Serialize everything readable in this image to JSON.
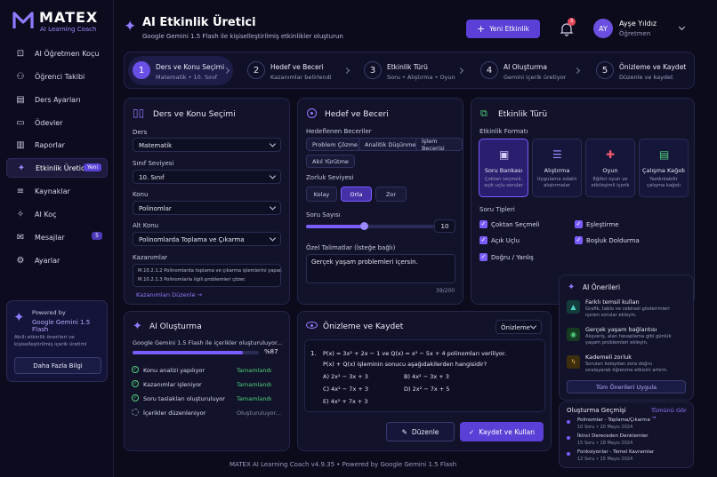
{
  "brand": {
    "name": "MATEX",
    "tagline": "AI Learning Coach"
  },
  "sidebar": {
    "items": [
      {
        "label": "AI Öğretmen Koçu",
        "icon": "book-user-icon"
      },
      {
        "label": "Öğrenci Takibi",
        "icon": "users-icon"
      },
      {
        "label": "Ders Ayarları",
        "icon": "book-icon"
      },
      {
        "label": "Ödevler",
        "icon": "clipboard-icon"
      },
      {
        "label": "Raporlar",
        "icon": "chart-icon"
      },
      {
        "label": "Etkinlik Üretici",
        "icon": "wand-icon",
        "badge": "Yeni"
      },
      {
        "label": "Kaynaklar",
        "icon": "layers-icon"
      },
      {
        "label": "AI Koç",
        "icon": "sparkle-icon"
      },
      {
        "label": "Mesajlar",
        "icon": "mail-icon",
        "badge": "5"
      },
      {
        "label": "Ayarlar",
        "icon": "gear-icon"
      }
    ],
    "promo": {
      "powered_by": "Powered by",
      "engine": "Google Gemini 1.5 Flash",
      "desc_line1": "Akıllı etkinlik önerileri ve",
      "desc_line2": "kişiselleştirilmiş içerik üretimi",
      "button": "Daha Fazla Bilgi"
    }
  },
  "header": {
    "title": "AI Etkinlik Üretici",
    "subtitle": "Google Gemini 1.5 Flash ile kişiselleştirilmiş etkinlikler oluşturun",
    "new_button": "Yeni Etkinlik",
    "notif_count": "3",
    "user": {
      "initials": "AY",
      "name": "Ayşe Yıldız",
      "role": "Öğretmen"
    }
  },
  "steps": [
    {
      "num": "1",
      "title": "Ders ve Konu Seçimi",
      "sub": "Matematik • 10. Sınıf"
    },
    {
      "num": "2",
      "title": "Hedef ve Beceri",
      "sub": "Kazanımlar belirlendi"
    },
    {
      "num": "3",
      "title": "Etkinlik Türü",
      "sub": "Soru • Alıştırma • Oyun"
    },
    {
      "num": "4",
      "title": "AI Oluşturma",
      "sub": "Gemini içerik üretiyor"
    },
    {
      "num": "5",
      "title": "Önizleme ve Kaydet",
      "sub": "Düzenle ve kaydet"
    }
  ],
  "subject_panel": {
    "title": "Ders ve Konu Seçimi",
    "ders_label": "Ders",
    "ders_value": "Matematik",
    "sinif_label": "Sınıf Seviyesi",
    "sinif_value": "10. Sınıf",
    "konu_label": "Konu",
    "konu_value": "Polinomlar",
    "altkonu_label": "Alt Konu",
    "altkonu_value": "Polinomlarda Toplama ve Çıkarma",
    "kazanim_label": "Kazanımlar",
    "kazanim_1": "M.10.2.1.2 Polinomlarda toplama ve çıkarma işlemlerini yapar.",
    "kazanim_2": "M.10.2.1.3 Polinomlarla ilgili problemleri çözer.",
    "kazanim_link": "Kazanımları Düzenle →"
  },
  "goals_panel": {
    "title": "Hedef ve Beceri",
    "skills_label": "Hedeflenen Beceriler",
    "skills": [
      "Problem Çözme",
      "Analitik Düşünme",
      "İşlem Becerisi",
      "Akıl Yürütme"
    ],
    "difficulty_label": "Zorluk Seviyesi",
    "difficulty": [
      "Kolay",
      "Orta",
      "Zor"
    ],
    "difficulty_selected": "Orta",
    "count_label": "Soru Sayısı",
    "count_value": "10",
    "count_fraction": 0.45,
    "notes_label": "Özel Talimatlar (İsteğe bağlı)",
    "notes_value": "Gerçek yaşam problemleri içersin.",
    "notes_counter": "39/200"
  },
  "type_panel": {
    "title": "Etkinlik Türü",
    "format_label": "Etkinlik Formatı",
    "formats": [
      {
        "title": "Soru Bankası",
        "d1": "Çoktan seçmeli,",
        "d2": "açık uçlu sorular",
        "icon": "list-check-icon"
      },
      {
        "title": "Alıştırma",
        "d1": "Uygulama odaklı",
        "d2": "alıştırmalar",
        "icon": "document-icon"
      },
      {
        "title": "Oyun",
        "d1": "Eğitici oyun ve",
        "d2": "etkileşimli içerik",
        "icon": "gamepad-icon"
      },
      {
        "title": "Çalışma Kağıdı",
        "d1": "Yazdırılabilir",
        "d2": "çalışma kağıdı",
        "icon": "sheet-icon"
      }
    ],
    "qtypes_label": "Soru Tipleri",
    "qtypes": [
      "Çoktan Seçmeli",
      "Eşleştirme",
      "Açık Uçlu",
      "Boşluk Doldurma",
      "Doğru / Yanlış"
    ]
  },
  "ai_panel": {
    "title": "AI Oluşturma",
    "status": "Google Gemini 1.5 Flash ile içerikler oluşturuluyor...",
    "percent": "%87",
    "progress": 0.87,
    "tasks": [
      {
        "label": "Konu analizi yapılıyor",
        "state": "Tamamlandı"
      },
      {
        "label": "Kazanımlar işleniyor",
        "state": "Tamamlandı"
      },
      {
        "label": "Soru taslakları oluşturuluyor",
        "state": "Tamamlandı"
      },
      {
        "label": "İçerikler düzenleniyor",
        "state": "Oluşturuluyor..."
      }
    ]
  },
  "preview_panel": {
    "title": "Önizleme ve Kaydet",
    "select_value": "Önizleme",
    "q_num": "1.",
    "q_line1": "P(x) = 3x² + 2x − 1 ve Q(x) = x² − 5x + 4 polinomları veriliyor.",
    "q_line2": "P(x) + Q(x) işleminin sonucu aşağıdakilerden hangisidir?",
    "opt_a": "A) 2x² − 3x + 3",
    "opt_b": "B) 4x² − 3x + 3",
    "opt_c": "C) 4x² − 7x + 3",
    "opt_d": "D) 2x² − 7x + 5",
    "opt_e": "E) 4x² + 7x + 3",
    "edit_button": "Düzenle",
    "save_button": "Kaydet ve Kullan"
  },
  "suggestions": {
    "title": "AI Önerileri",
    "items": [
      {
        "title": "Farklı temsil kullan",
        "d1": "Grafik, tablo ve cebirsel gösterimleri",
        "d2": "içeren sorular ekleyin."
      },
      {
        "title": "Gerçek yaşam bağlantısı",
        "d1": "Alışveriş, alan hesaplama gibi günlük",
        "d2": "yaşam problemleri ekleyin."
      },
      {
        "title": "Kademeli zorluk",
        "d1": "Soruları kolaydan zora doğru",
        "d2": "sıralayarak öğrenme etkisini artırın."
      }
    ],
    "apply_all": "Tüm Önerileri Uygula"
  },
  "history": {
    "title": "Oluşturma Geçmişi",
    "see_all": "Tümünü Gör →",
    "items": [
      {
        "title": "Polinomlar - Toplama/Çıkarma",
        "date": "10 Soru • 20 Mayıs 2024"
      },
      {
        "title": "İkinci Dereceden Denklemler",
        "date": "15 Soru • 18 Mayıs 2024"
      },
      {
        "title": "Fonksiyonlar - Temel Kavramlar",
        "date": "12 Soru • 15 Mayıs 2024"
      }
    ]
  },
  "footer": "MATEX AI Learning Coach v4.9.35 • Powered by Google Gemini 1.5 Flash",
  "colors": {
    "accent": "#7b5cff",
    "background": "#0b0b1c",
    "panel": "#12132a",
    "success": "#4fd17a"
  }
}
